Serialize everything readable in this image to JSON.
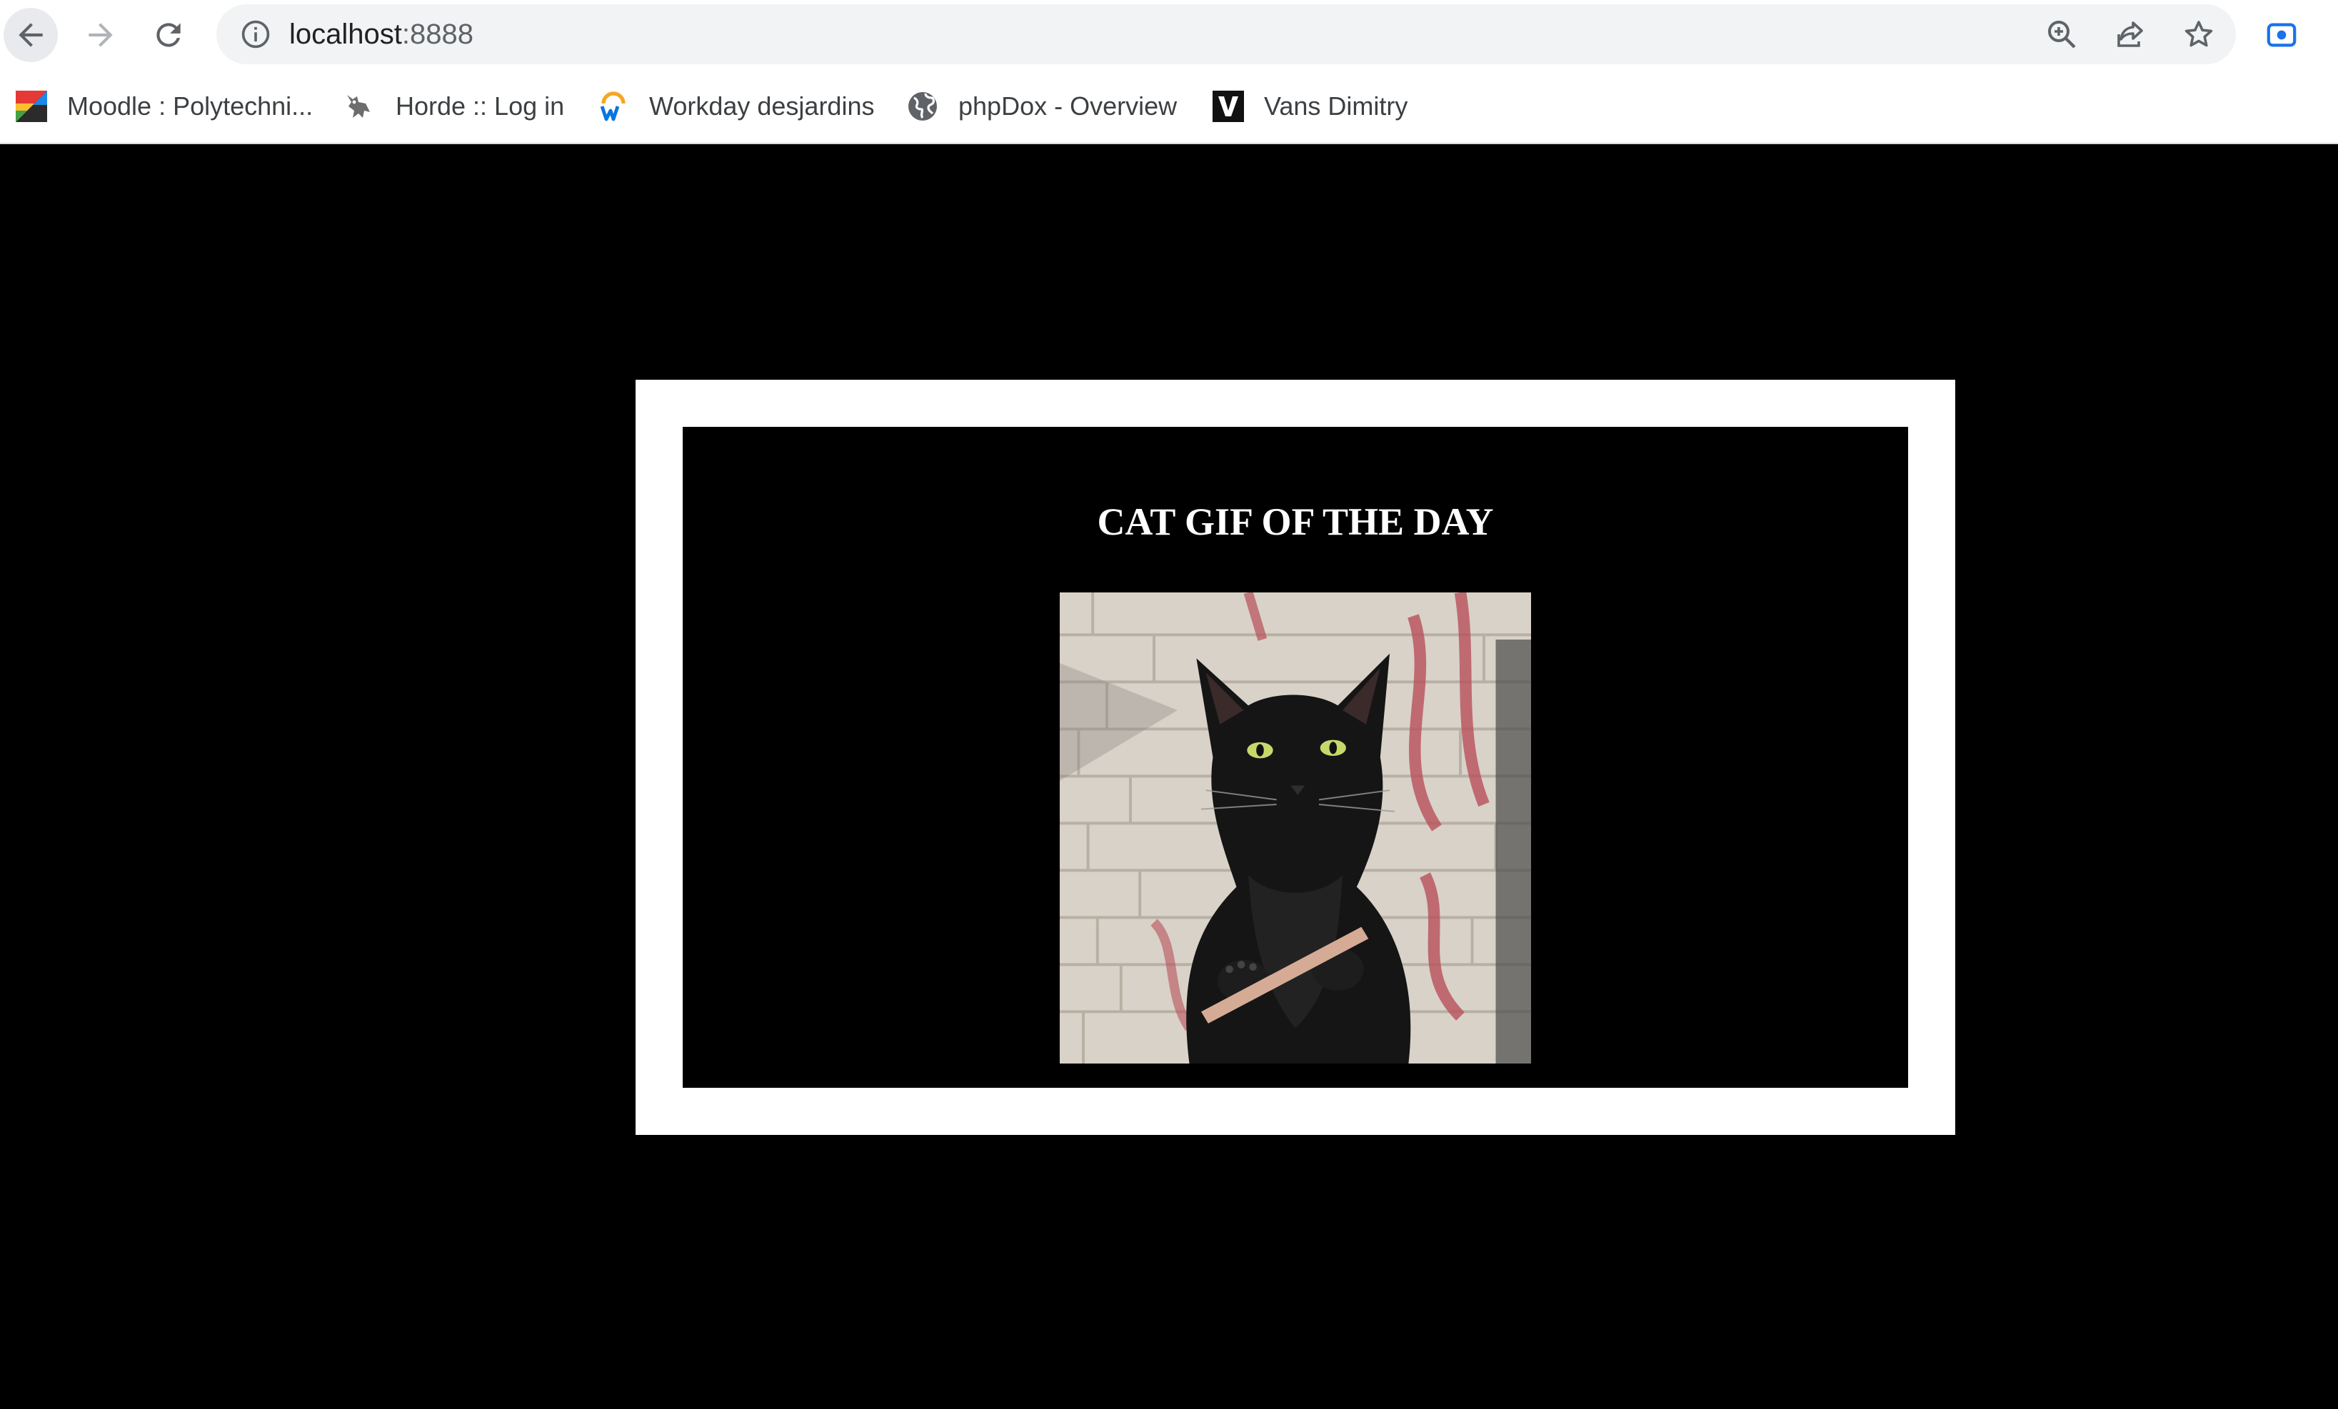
{
  "browser": {
    "url_host": "localhost",
    "url_port": ":8888",
    "bookmarks": [
      {
        "label": "Moodle : Polytechni...",
        "icon": "moodle-icon"
      },
      {
        "label": "Horde :: Log in",
        "icon": "horde-icon"
      },
      {
        "label": "Workday desjardins",
        "icon": "workday-icon"
      },
      {
        "label": "phpDox - Overview",
        "icon": "globe-icon"
      },
      {
        "label": "Vans Dimitry",
        "icon": "vans-icon"
      }
    ],
    "toolbar_icons": [
      "back-arrow-icon",
      "forward-arrow-icon",
      "reload-icon",
      "info-icon",
      "zoom-icon",
      "share-icon",
      "star-icon",
      "screencast-icon"
    ]
  },
  "page": {
    "title": "CAT GIF OF THE DAY",
    "image": {
      "subject": "black cat holding a nail file",
      "alt": ""
    }
  },
  "colors": {
    "page_bg": "#000000",
    "frame": "#ffffff",
    "chrome_bg": "#ffffff",
    "omnibox_bg": "#f1f3f4",
    "accent": "#1a73e8"
  }
}
